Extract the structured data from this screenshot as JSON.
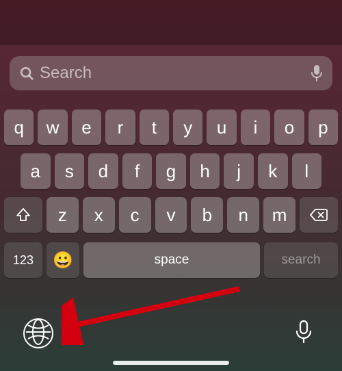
{
  "search": {
    "placeholder": "Search"
  },
  "keyboard": {
    "row1": [
      "q",
      "w",
      "e",
      "r",
      "t",
      "y",
      "u",
      "i",
      "o",
      "p"
    ],
    "row2": [
      "a",
      "s",
      "d",
      "f",
      "g",
      "h",
      "j",
      "k",
      "l"
    ],
    "row3": [
      "z",
      "x",
      "c",
      "v",
      "b",
      "n",
      "m"
    ],
    "numKey": "123",
    "spaceLabel": "space",
    "searchLabel": "search"
  }
}
